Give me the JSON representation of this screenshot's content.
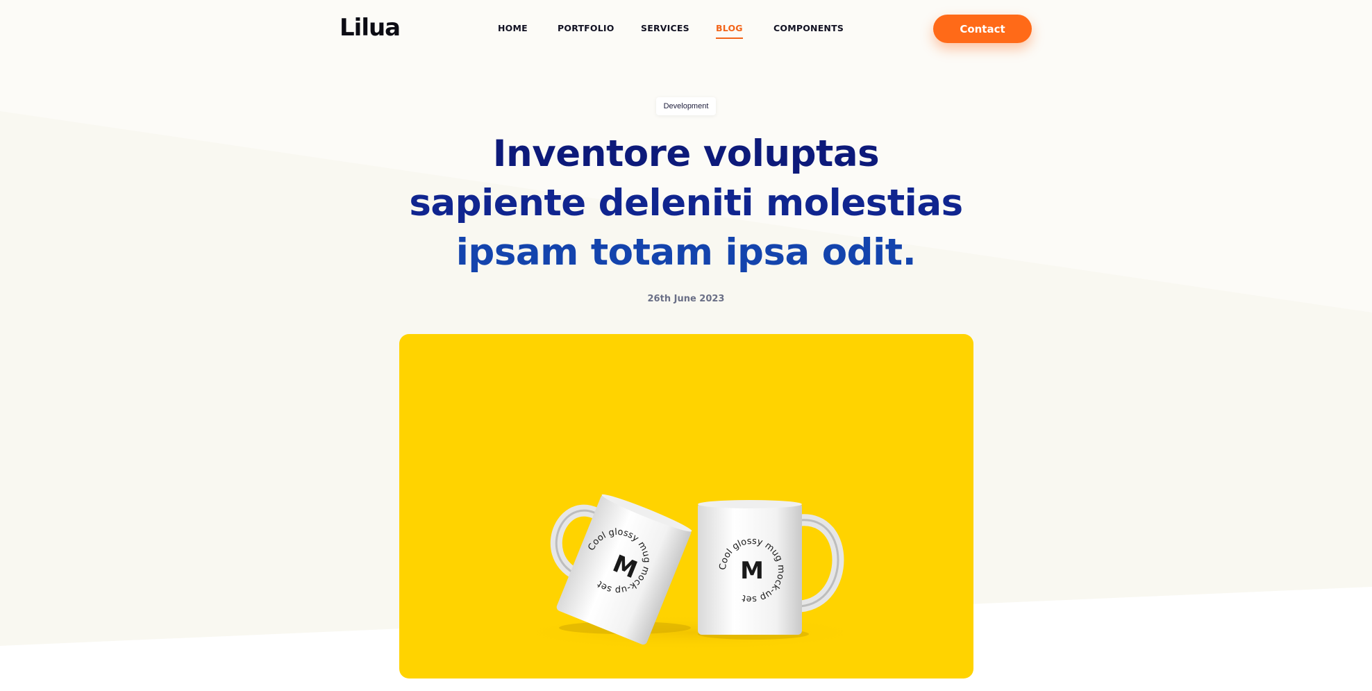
{
  "brand": {
    "logo": "Lilua"
  },
  "nav": {
    "items": [
      {
        "label": "HOME",
        "active": false
      },
      {
        "label": "PORTFOLIO",
        "active": false
      },
      {
        "label": "SERVICES",
        "active": false
      },
      {
        "label": "BLOG",
        "active": true
      },
      {
        "label": "COMPONENTS",
        "active": false
      }
    ],
    "contact_label": "Contact"
  },
  "post": {
    "category": "Development",
    "title_lines": [
      "Inventore voluptas",
      "sapiente deleniti molestias",
      "ipsam totam ipsa odit."
    ],
    "date": "26th June 2023"
  },
  "hero": {
    "mug_letter": "M",
    "mug_text": "Cool glossy mug mock-up set"
  },
  "colors": {
    "accent": "#ff6a18",
    "title_dark": "#0d1a7a",
    "title_blue": "#1444ad",
    "hero_bg": "#ffd300",
    "page_bg": "#fcfbf7"
  }
}
